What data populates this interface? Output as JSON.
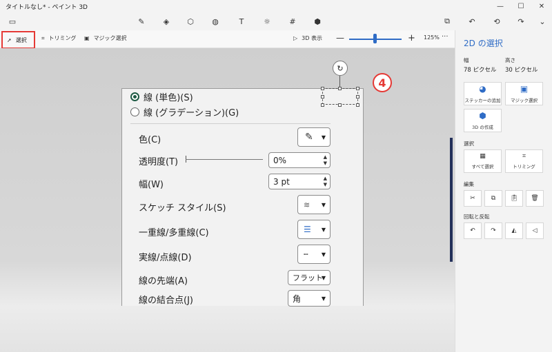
{
  "window": {
    "title": "タイトルなし* - ペイント 3D",
    "controls": [
      "minimize-icon",
      "maximize-icon",
      "close-icon"
    ]
  },
  "toolbar": {
    "left_icon": "menu-icon",
    "tools": [
      "brush-icon",
      "2d-shapes-icon",
      "3d-shapes-icon",
      "stickers-icon",
      "text-icon",
      "effects-icon",
      "canvas-icon",
      "3d-library-icon"
    ],
    "right_tools": [
      "paste-icon",
      "undo-icon",
      "history-icon",
      "redo-icon",
      "expand-icon"
    ]
  },
  "subtoolbar": {
    "select_label": "選択",
    "crop_label": "トリミング",
    "magic_select_label": "マジック選択",
    "view3d_label": "3D 表示",
    "zoom_minus": "—",
    "zoom_plus": "+",
    "zoom_percent": "125%",
    "more": "···",
    "zoom_level": 0.55
  },
  "dialog": {
    "solid_line_label": "線 (単色)(S)",
    "gradient_line_label": "線 (グラデーション)(G)",
    "props": {
      "color_label": "色(C)",
      "transparency_label": "透明度(T)",
      "transparency_value": "0%",
      "width_label": "幅(W)",
      "width_value": "3 pt",
      "sketch_label": "スケッチ スタイル(S)",
      "compound_label": "一重線/多重線(C)",
      "dash_label": "実線/点線(D)",
      "cap_label": "線の先端(A)",
      "cap_value": "フラット",
      "join_label": "線の結合点(J)",
      "join_value": "角"
    }
  },
  "annotation": {
    "badge": "4"
  },
  "right_panel": {
    "title": "2D の選択",
    "width_label": "幅",
    "width_value": "78 ピクセル",
    "height_label": "高さ",
    "height_value": "30 ピクセル",
    "add_sticker": "ステッカーの追加",
    "magic_select": "マジック選択",
    "make_3d": "3D の作成",
    "select_section": "選択",
    "select_all": "すべて選択",
    "crop": "トリミング",
    "edit_section": "編集",
    "rotate_section": "回転と反転"
  }
}
